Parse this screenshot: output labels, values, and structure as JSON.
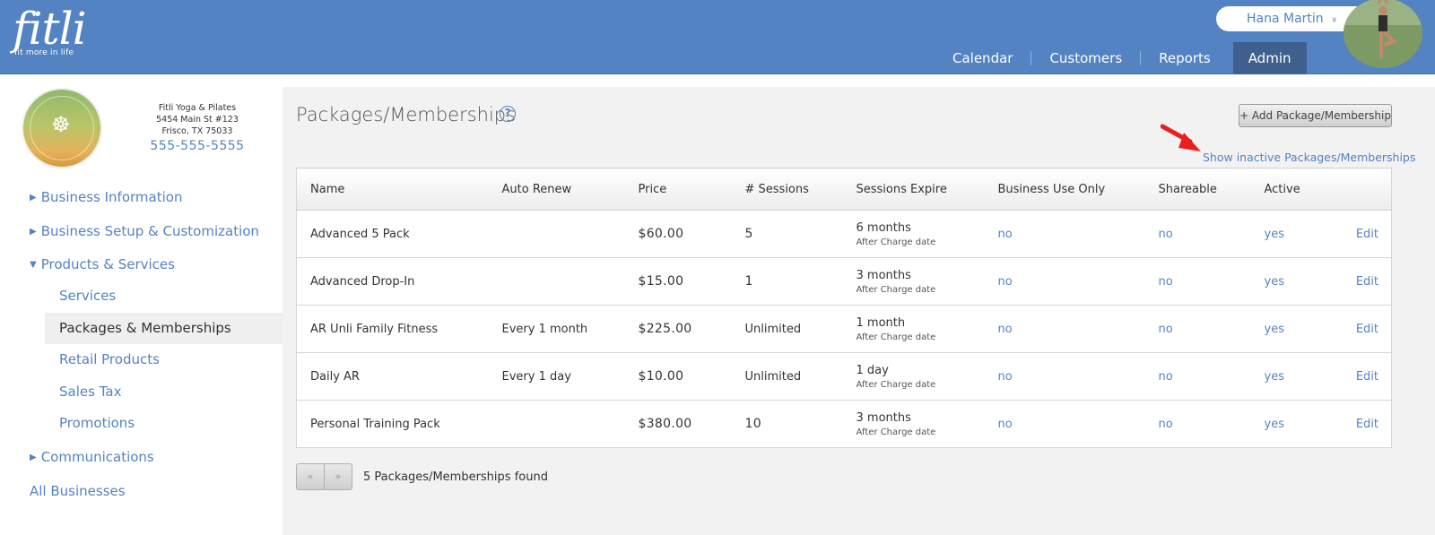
{
  "header": {
    "logo_text": "fitli",
    "logo_tagline": "fit more in life",
    "user_name": "Hana Martin",
    "user_chevron": "»",
    "nav": [
      "Calendar",
      "Customers",
      "Reports",
      "Admin"
    ],
    "active_nav": "Admin"
  },
  "business": {
    "name": "Fitli Yoga & Pilates",
    "address1": "5454 Main St #123",
    "address2": "Frisco, TX 75033",
    "phone": "555-555-5555",
    "logo_text": "FITLI YOGA & PILATES"
  },
  "sidebar": {
    "items": [
      {
        "label": "Business Information",
        "expanded": false
      },
      {
        "label": "Business Setup & Customization",
        "expanded": false
      },
      {
        "label": "Products & Services",
        "expanded": true
      },
      {
        "label": "Communications",
        "expanded": false
      }
    ],
    "sub_items": [
      "Services",
      "Packages & Memberships",
      "Retail Products",
      "Sales Tax",
      "Promotions"
    ],
    "active_sub": "Packages & Memberships",
    "all_businesses": "All Businesses"
  },
  "main": {
    "title": "Packages/Memberships",
    "help_icon": "?",
    "add_button": "+ Add Package/Membership",
    "show_inactive": "Show inactive Packages/Memberships",
    "columns": [
      "Name",
      "Auto Renew",
      "Price",
      "# Sessions",
      "Sessions Expire",
      "Business Use Only",
      "Shareable",
      "Active",
      ""
    ],
    "rows": [
      {
        "name": "Advanced 5 Pack",
        "auto_renew": "",
        "price": "$60.00",
        "sessions": "5",
        "expire": "6 months",
        "expire_note": "After Charge date",
        "business_use_only": "no",
        "shareable": "no",
        "active": "yes",
        "edit": "Edit"
      },
      {
        "name": "Advanced Drop-In",
        "auto_renew": "",
        "price": "$15.00",
        "sessions": "1",
        "expire": "3 months",
        "expire_note": "After Charge date",
        "business_use_only": "no",
        "shareable": "no",
        "active": "yes",
        "edit": "Edit"
      },
      {
        "name": "AR Unli Family Fitness",
        "auto_renew": "Every 1 month",
        "price": "$225.00",
        "sessions": "Unlimited",
        "expire": "1 month",
        "expire_note": "After Charge date",
        "business_use_only": "no",
        "shareable": "no",
        "active": "yes",
        "edit": "Edit"
      },
      {
        "name": "Daily AR",
        "auto_renew": "Every 1 day",
        "price": "$10.00",
        "sessions": "Unlimited",
        "expire": "1 day",
        "expire_note": "After Charge date",
        "business_use_only": "no",
        "shareable": "no",
        "active": "yes",
        "edit": "Edit"
      },
      {
        "name": "Personal Training Pack",
        "auto_renew": "",
        "price": "$380.00",
        "sessions": "10",
        "expire": "3 months",
        "expire_note": "After Charge date",
        "business_use_only": "no",
        "shareable": "no",
        "active": "yes",
        "edit": "Edit"
      }
    ],
    "pager_prev": "«",
    "pager_next": "»",
    "found_text": "5 Packages/Memberships found"
  },
  "colors": {
    "brand_blue": "#5383c3",
    "nav_active": "#3f5f8e",
    "annotation_arrow": "#e8201f"
  },
  "icons": {
    "help": "help-circle-icon",
    "arrow": "red-pointer-arrow",
    "expanded": "triangle-down-icon",
    "collapsed": "triangle-right-icon"
  }
}
